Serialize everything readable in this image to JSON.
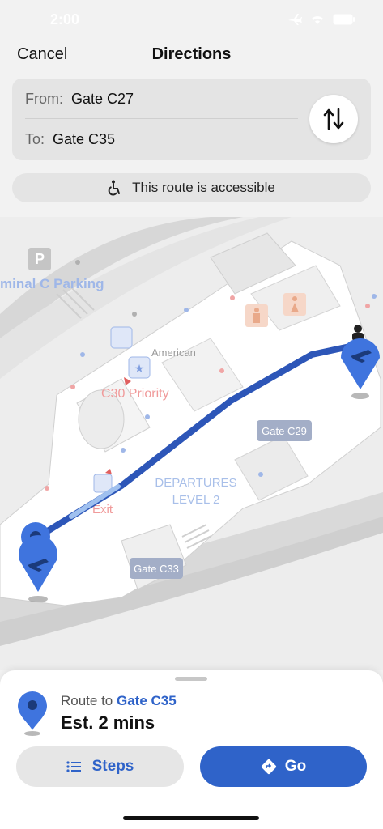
{
  "status": {
    "time": "2:00"
  },
  "header": {
    "cancel_label": "Cancel",
    "title": "Directions"
  },
  "route": {
    "from_label": "From:",
    "from_value": "Gate C27",
    "to_label": "To:",
    "to_value": "Gate C35"
  },
  "accessible": {
    "text": "This route is accessible"
  },
  "map": {
    "labels": {
      "parking": "minal C Parking",
      "american": "American",
      "priority": "C30 Priority",
      "departures_1": "DEPARTURES",
      "departures_2": "LEVEL 2",
      "exit": "Exit",
      "gate_c29": "Gate C29",
      "gate_c33": "Gate C33",
      "parking_sign": "P"
    }
  },
  "sheet": {
    "route_to_prefix": "Route to ",
    "route_to_gate": "Gate C35",
    "estimate": "Est. 2 mins",
    "steps_label": "Steps",
    "go_label": "Go"
  },
  "colors": {
    "accent": "#2f63c9",
    "route_line": "#2d56b8",
    "pin": "#3f74de"
  }
}
